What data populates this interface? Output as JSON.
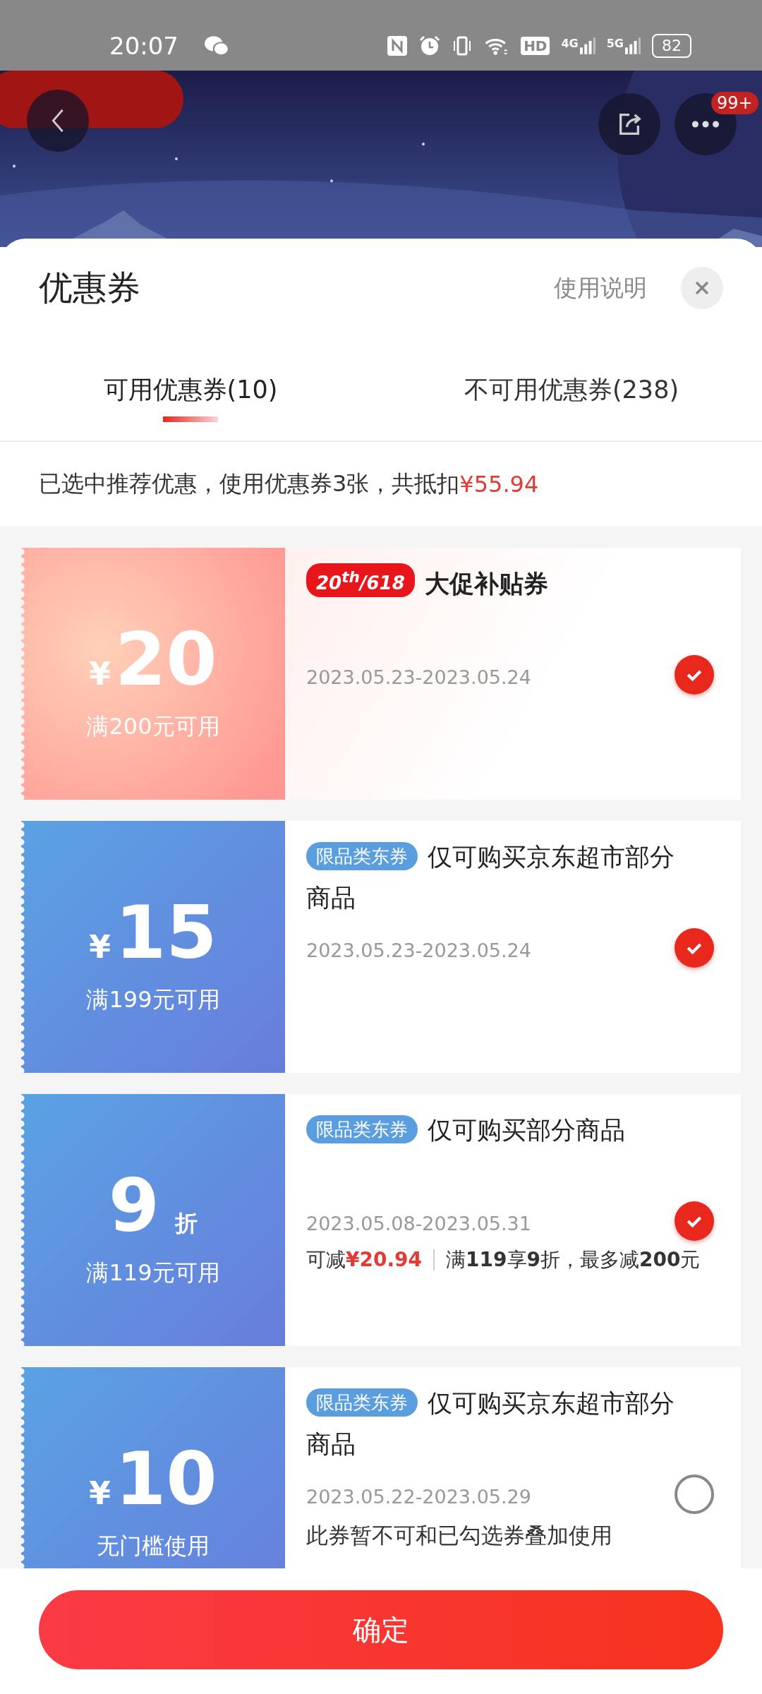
{
  "status_bar": {
    "time": "20:07",
    "hd_label": "HD",
    "network_labels": [
      "4G",
      "5G"
    ],
    "battery": "82"
  },
  "header": {
    "kind": "picture",
    "badge": "99+"
  },
  "sheet": {
    "title": "优惠券",
    "help_link": "使用说明"
  },
  "tabs": [
    {
      "label": "可用优惠券(10)",
      "selected": true
    },
    {
      "label": "不可用优惠券(238)",
      "selected": false
    }
  ],
  "summary": {
    "text": "已选中推荐优惠，使用优惠券3张，共抵扣",
    "amount": "¥55.94"
  },
  "coupons": [
    {
      "kind": "amount",
      "promo": true,
      "currency": "¥",
      "value": "20",
      "condition": "满200元可用",
      "tag": "20$^{th}$/618",
      "title": "大促补贴券",
      "dates": "2023.05.23-2023.05.24",
      "checked": true
    },
    {
      "kind": "amount",
      "promo": false,
      "currency": "¥",
      "value": "15",
      "condition": "满199元可用",
      "tag": "限品类东券",
      "title": "仅可购买京东超市部分商品",
      "dates": "2023.05.23-2023.05.24",
      "checked": true
    },
    {
      "kind": "discount",
      "promo": false,
      "value": "9",
      "unit": "折",
      "condition": "满119元可用",
      "tag": "限品类东券",
      "title": "仅可购买部分商品",
      "dates": "2023.05.08-2023.05.31",
      "saving_label": "可减",
      "saving": "¥20.94",
      "rule": "满**119**享**9**折，最多减**200**元",
      "checked": true
    },
    {
      "kind": "amount",
      "promo": false,
      "currency": "¥",
      "value": "10",
      "condition": "无门槛使用",
      "tag": "限品类东券",
      "title": "仅可购买京东超市部分商品",
      "dates": "2023.05.22-2023.05.29",
      "note": "此券暂不可和已勾选券叠加使用",
      "checked": false
    }
  ],
  "confirm_button": "确定"
}
